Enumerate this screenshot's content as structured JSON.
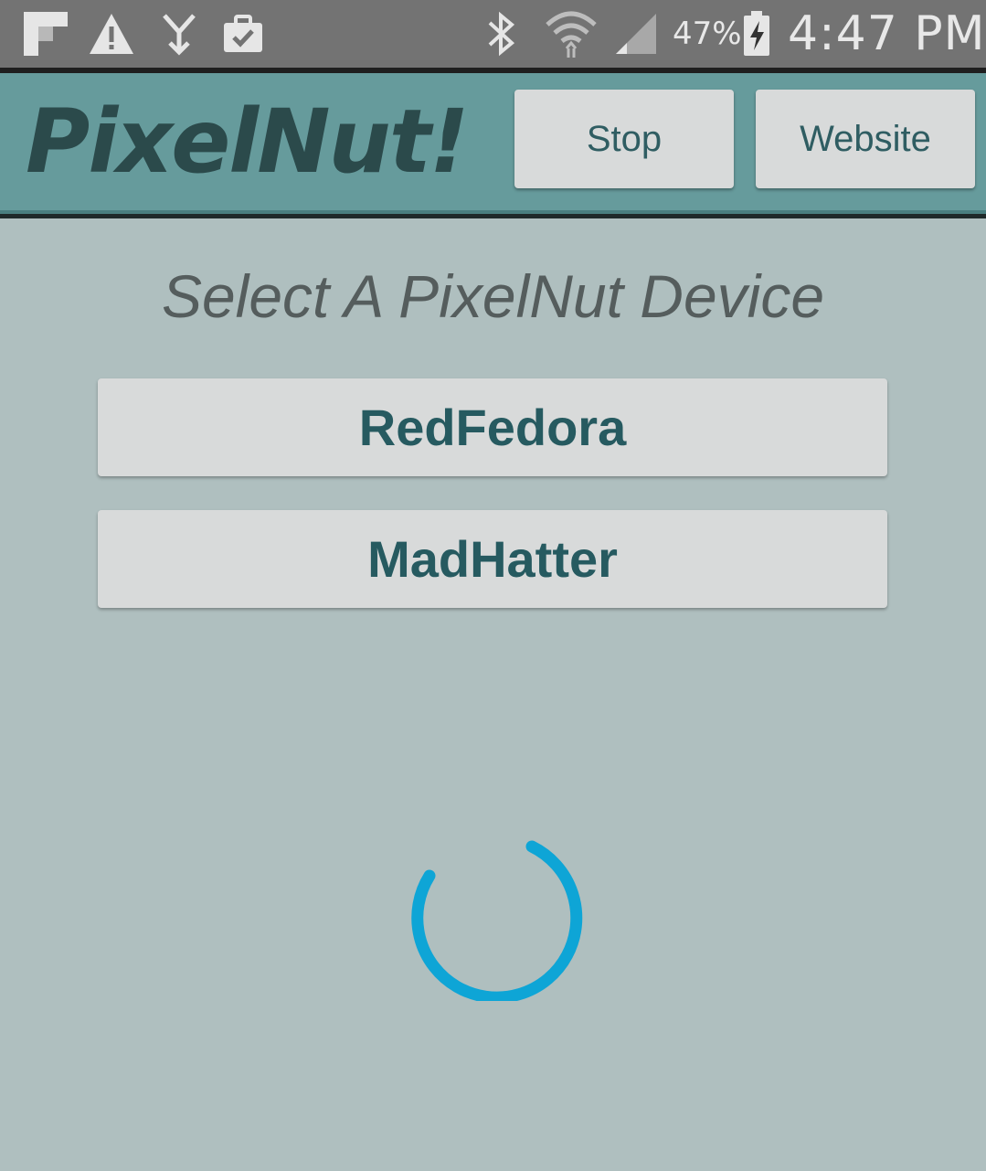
{
  "status_bar": {
    "icons": [
      "flipboard-icon",
      "warning-icon",
      "download-icon",
      "briefcase-check-icon",
      "bluetooth-icon",
      "wifi-icon",
      "signal-icon",
      "battery-charging-icon"
    ],
    "battery_percent": "47%",
    "time": "4:47 PM"
  },
  "header": {
    "app_title": "PixelNut!",
    "stop_label": "Stop",
    "website_label": "Website"
  },
  "main": {
    "heading": "Select A PixelNut Device",
    "devices": [
      "RedFedora",
      "MadHatter"
    ]
  },
  "colors": {
    "status_bar": "#737373",
    "app_bar": "#669b9c",
    "background": "#afbfbf",
    "button": "#d8dada",
    "button_text": "#265a60",
    "spinner": "#0ea5d6"
  }
}
